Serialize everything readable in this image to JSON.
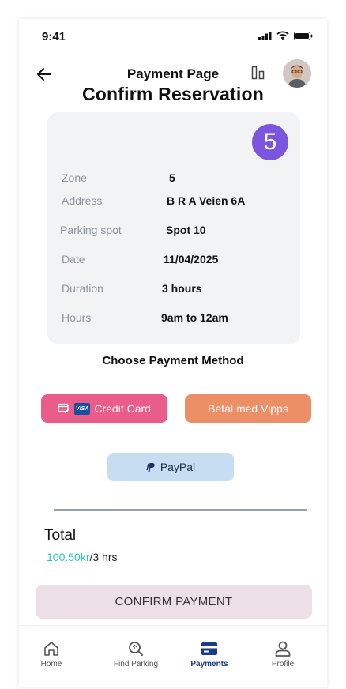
{
  "status_bar": {
    "time": "9:41"
  },
  "header": {
    "title": "Payment Page"
  },
  "heading": "Confirm Reservation",
  "reservation": {
    "zone_badge": "5",
    "rows": [
      {
        "label": "Zone",
        "value": "5"
      },
      {
        "label": "Address",
        "value": "B R A Veien 6A"
      },
      {
        "label": "Parking spot",
        "value": "Spot 10"
      },
      {
        "label": "Date",
        "value": "11/04/2025"
      },
      {
        "label": "Duration",
        "value": "3 hours"
      },
      {
        "label": "Hours",
        "value": "9am to 12am"
      }
    ]
  },
  "payment": {
    "section_title": "Choose Payment Method",
    "credit_card_label": "Credit Card",
    "visa_text": "VISA",
    "vipps_label": "Betal med Vipps",
    "paypal_label": "PayPal"
  },
  "total": {
    "label": "Total",
    "price": "100.50kr",
    "per": "/3 hrs"
  },
  "confirm_label": "CONFIRM PAYMENT",
  "nav": [
    {
      "label": "Home",
      "icon": "home-icon",
      "active": false
    },
    {
      "label": "Find Parking",
      "icon": "search-icon",
      "active": false
    },
    {
      "label": "Payments",
      "icon": "card-icon",
      "active": true
    },
    {
      "label": "Profile",
      "icon": "profile-icon",
      "active": false
    }
  ],
  "colors": {
    "accent_purple": "#7c55de",
    "credit_card_btn": "#ea5c89",
    "vipps_btn": "#ec8f66",
    "paypal_btn": "#c7ddf2",
    "price": "#2bc7b8",
    "confirm_btn": "#ecdfe5",
    "nav_active": "#1b3a8a"
  }
}
